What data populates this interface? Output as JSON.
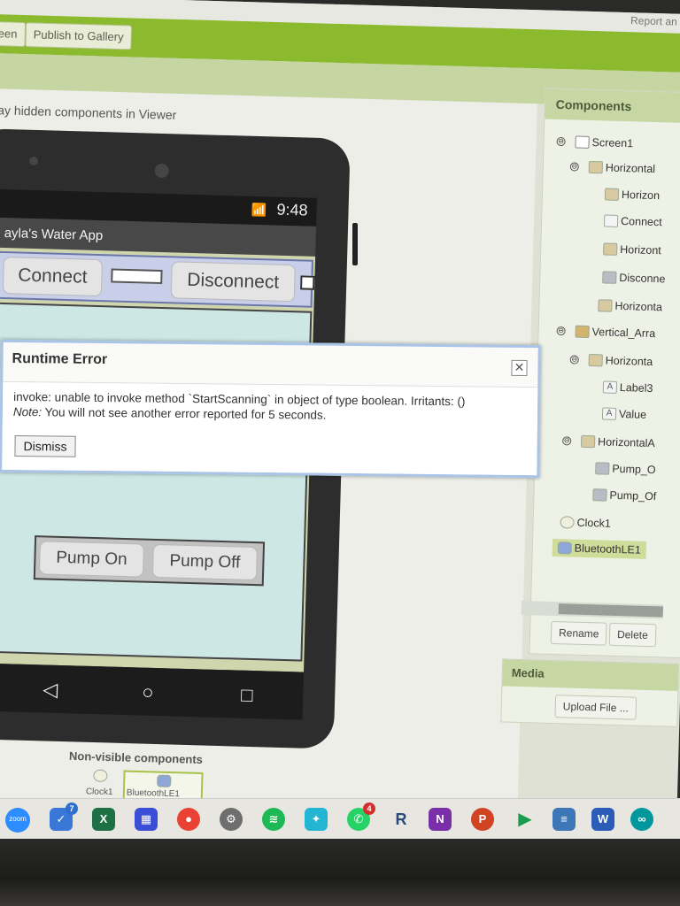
{
  "toolbar": {
    "screen_label": "een",
    "publish_label": "Publish to Gallery",
    "report_label": "Report an Iss"
  },
  "viewer": {
    "hidden_components_label": "play hidden components in Viewer",
    "nonvisible_label": "Non-visible components",
    "nonvisible_clock": "Clock1",
    "nonvisible_bt": "BluetoothLE1"
  },
  "phone": {
    "time": "9:48",
    "app_title": "ayla's Water App",
    "connect_label": "Connect",
    "disconnect_label": "Disconnect",
    "pump_on_label": "Pump On",
    "pump_off_label": "Pump Off"
  },
  "dialog": {
    "title": "Runtime Error",
    "message": "invoke: unable to invoke method `StartScanning` in object of type boolean. Irritants: ()",
    "note_prefix": "Note:",
    "note_text": " You will not see another error reported for 5 seconds.",
    "dismiss_label": "Dismiss",
    "close_symbol": "✕"
  },
  "components": {
    "header": "Components",
    "items": [
      {
        "label": "Screen1",
        "toggle": "⊖"
      },
      {
        "label": "Horizontal",
        "toggle": "⊖"
      },
      {
        "label": "Horizon",
        "toggle": ""
      },
      {
        "label": "Connect",
        "toggle": ""
      },
      {
        "label": "Horizont",
        "toggle": ""
      },
      {
        "label": "Disconne",
        "toggle": ""
      },
      {
        "label": "Horizonta",
        "toggle": ""
      },
      {
        "label": "Vertical_Arra",
        "toggle": "⊖"
      },
      {
        "label": "Horizonta",
        "toggle": "⊖"
      },
      {
        "label": "Label3",
        "toggle": ""
      },
      {
        "label": "Value",
        "toggle": ""
      },
      {
        "label": "HorizontalA",
        "toggle": "⊖"
      },
      {
        "label": "Pump_O",
        "toggle": ""
      },
      {
        "label": "Pump_Of",
        "toggle": ""
      },
      {
        "label": "Clock1",
        "toggle": ""
      },
      {
        "label": "BluetoothLE1",
        "toggle": ""
      }
    ],
    "rename_label": "Rename",
    "delete_label": "Delete"
  },
  "media": {
    "header": "Media",
    "upload_label": "Upload File ..."
  },
  "taskbar": {
    "zoom_label": "zoom",
    "todo_badge": "7",
    "whatsapp_badge": "4",
    "excel_label": "X",
    "onenote_label": "N",
    "powerpoint_label": "P",
    "word_label": "W",
    "r_label": "R"
  }
}
